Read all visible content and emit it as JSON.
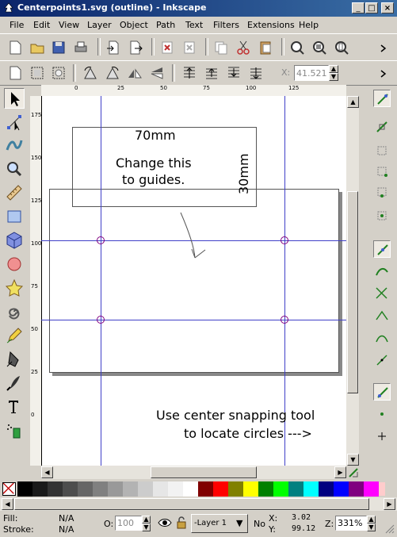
{
  "window": {
    "title": "Centerpoints1.svg (outline) - Inkscape",
    "minimize_label": "_",
    "maximize_label": "□",
    "close_label": "×"
  },
  "menu": [
    "File",
    "Edit",
    "View",
    "Layer",
    "Object",
    "Path",
    "Text",
    "Filters",
    "Extensions",
    "Help"
  ],
  "toolbar": {
    "x_label": "X:",
    "x_value": "41.521"
  },
  "rulers": {
    "h_labels": [
      "0",
      "25",
      "50",
      "75",
      "100",
      "125"
    ],
    "v_labels": [
      "175",
      "150",
      "125",
      "100",
      "75",
      "50",
      "25",
      "0"
    ]
  },
  "canvas": {
    "width_annotation": "70mm",
    "note_line1": "Change this",
    "note_line2": "to guides.",
    "height_annotation": "30mm",
    "hint_line1": "Use center snapping tool",
    "hint_line2": "to locate circles  --->"
  },
  "palette": {
    "colors": [
      "#000000",
      "#1a1a1a",
      "#333333",
      "#4d4d4d",
      "#666666",
      "#808080",
      "#999999",
      "#b3b3b3",
      "#cccccc",
      "#e6e6e6",
      "#f2f2f2",
      "#ffffff",
      "#800000",
      "#ff0000",
      "#808000",
      "#ffff00",
      "#008000",
      "#00ff00",
      "#008080",
      "#00ffff",
      "#000080",
      "#0000ff",
      "#800080",
      "#ff00ff"
    ]
  },
  "status": {
    "fill_label": "Fill:",
    "fill_value": "N/A",
    "stroke_label": "Stroke:",
    "stroke_value": "N/A",
    "opacity_label": "O:",
    "opacity_value": "100",
    "layer_value": "-Layer 1",
    "no_label": "No",
    "x_label": "X:",
    "x_value": "3.02",
    "y_label": "Y:",
    "y_value": "99.12",
    "zoom_label": "Z:",
    "zoom_value": "331%"
  },
  "colors": {
    "guide": "#4040c8",
    "title_start": "#0a246a",
    "title_end": "#3a6ea5"
  }
}
